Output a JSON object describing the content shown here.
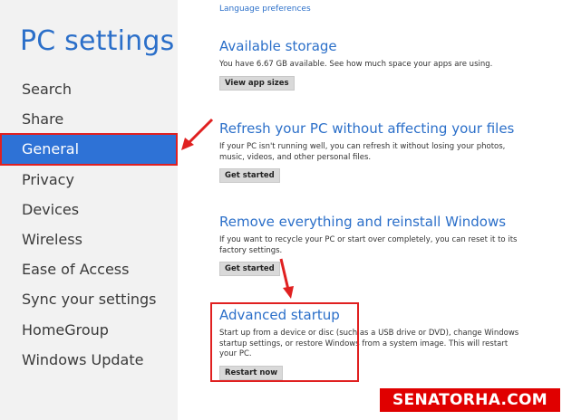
{
  "sidebar": {
    "title": "PC settings",
    "items": [
      {
        "label": "Search"
      },
      {
        "label": "Share"
      },
      {
        "label": "General",
        "selected": true
      },
      {
        "label": "Privacy"
      },
      {
        "label": "Devices"
      },
      {
        "label": "Wireless"
      },
      {
        "label": "Ease of Access"
      },
      {
        "label": "Sync your settings"
      },
      {
        "label": "HomeGroup"
      },
      {
        "label": "Windows Update"
      }
    ]
  },
  "main": {
    "top_link": "Language preferences",
    "sections": [
      {
        "heading": "Available storage",
        "text": "You have 6.67 GB available. See how much space your apps are using.",
        "button": "View app sizes"
      },
      {
        "heading": "Refresh your PC without affecting your files",
        "text": "If your PC isn't running well, you can refresh it without losing your photos, music, videos, and other personal files.",
        "button": "Get started"
      },
      {
        "heading": "Remove everything and reinstall Windows",
        "text": "If you want to recycle your PC or start over completely, you can reset it to its factory settings.",
        "button": "Get started"
      },
      {
        "heading": "Advanced startup",
        "text": "Start up from a device or disc (such as a USB drive or DVD), change Windows startup settings, or restore Windows from a system image. This will restart your PC.",
        "button": "Restart now"
      }
    ]
  },
  "watermark": "SENATORHA.COM",
  "colors": {
    "accent": "#2b6fc9",
    "selected_bg": "#2e72d6",
    "annotation_red": "#e02020"
  }
}
